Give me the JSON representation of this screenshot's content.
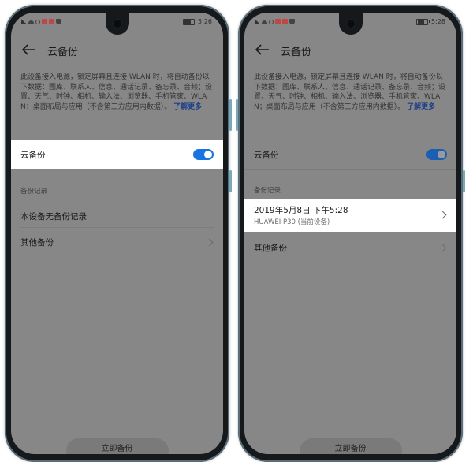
{
  "left": {
    "status": {
      "time": "5:26"
    },
    "title": "云备份",
    "description": "此设备接入电源，锁定屏幕且连接 WLAN 时，将自动备份以下数据：图库、联系人、信息、通话记录、备忘录、音频；设置、天气、时钟、相机、输入法、浏览器、手机管家、WLAN；桌面布局与应用（不含第三方应用内数据）。",
    "learn_more": "了解更多",
    "cloud_backup_label": "云备份",
    "cloud_backup_on": true,
    "records_header": "备份记录",
    "no_records": "本设备无备份记录",
    "other_backups": "其他备份",
    "backup_now": "立即备份"
  },
  "right": {
    "status": {
      "time": "5:28"
    },
    "title": "云备份",
    "description": "此设备接入电源，锁定屏幕且连接 WLAN 时，将自动备份以下数据：图库、联系人、信息、通话记录、备忘录、音频；设置、天气、时钟、相机、输入法、浏览器、手机管家、WLAN；桌面布局与应用（不含第三方应用内数据）。",
    "learn_more": "了解更多",
    "cloud_backup_label": "云备份",
    "cloud_backup_on": true,
    "records_header": "备份记录",
    "record_date": "2019年5月8日 下午5:28",
    "record_device": "HUAWEI P30 (当前设备)",
    "other_backups": "其他备份",
    "backup_now": "立即备份"
  },
  "colors": {
    "accent": "#1874e0",
    "link": "#1b3f8a",
    "dim_overlay": "#878787"
  }
}
